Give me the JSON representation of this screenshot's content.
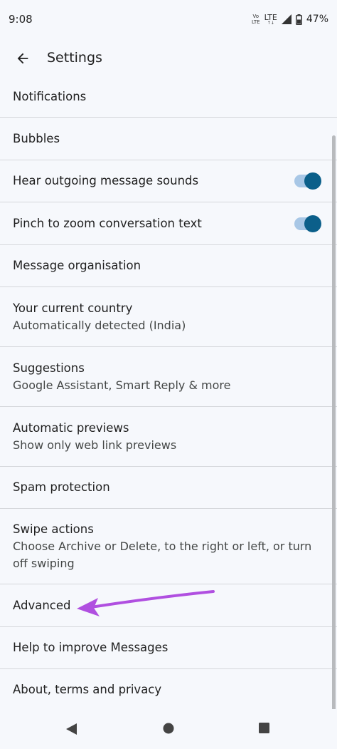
{
  "status_bar": {
    "time": "9:08",
    "volte_top": "Vo",
    "volte_bottom": "LTE",
    "network": "LTE",
    "net_arrows": "↑↓",
    "battery_percent": "47%"
  },
  "app_bar": {
    "title": "Settings",
    "back_icon": "arrow-back-icon"
  },
  "items": [
    {
      "title": "Notifications"
    },
    {
      "title": "Bubbles"
    },
    {
      "title": "Hear outgoing message sounds",
      "toggle": true
    },
    {
      "title": "Pinch to zoom conversation text",
      "toggle": true
    },
    {
      "title": "Message organisation"
    },
    {
      "title": "Your current country",
      "subtitle": "Automatically detected (India)"
    },
    {
      "title": "Suggestions",
      "subtitle": "Google Assistant, Smart Reply & more"
    },
    {
      "title": "Automatic previews",
      "subtitle": "Show only web link previews"
    },
    {
      "title": "Spam protection"
    },
    {
      "title": "Swipe actions",
      "subtitle": "Choose Archive or Delete, to the right or left, or turn off swiping"
    },
    {
      "title": "Advanced"
    },
    {
      "title": "Help to improve Messages"
    },
    {
      "title": "About, terms and privacy"
    }
  ],
  "colors": {
    "background": "#f6f8fc",
    "toggle_track": "#a8c7e6",
    "toggle_knob": "#0b5f8a",
    "annotation_arrow": "#b04fe0"
  },
  "nav_bar": {
    "back": "triangle-back-icon",
    "home": "circle-home-icon",
    "recents": "square-recents-icon"
  }
}
